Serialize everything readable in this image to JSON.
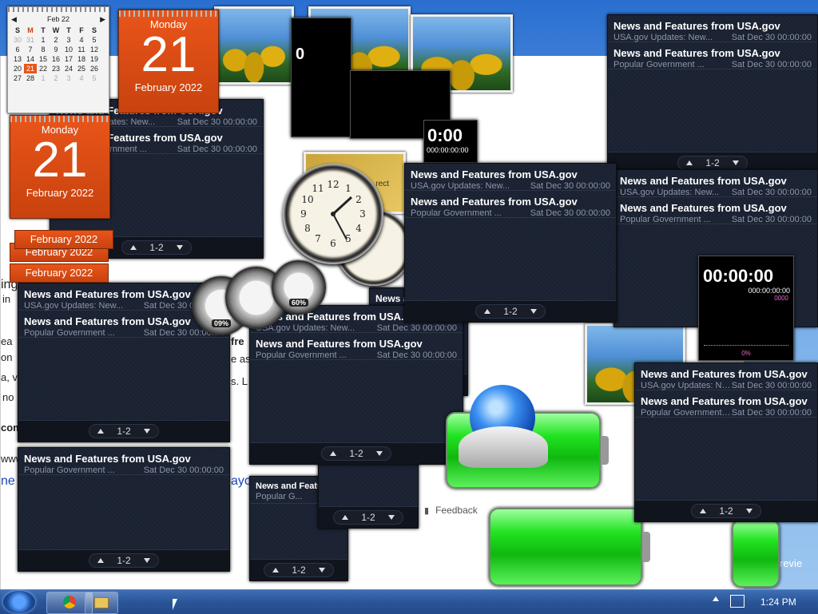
{
  "calendar_mini": {
    "month": "Feb 22",
    "weekdays": [
      "S",
      "M",
      "T",
      "W",
      "T",
      "F",
      "S"
    ],
    "rows": [
      [
        "30",
        "31",
        "1",
        "2",
        "3",
        "4",
        "5"
      ],
      [
        "6",
        "7",
        "8",
        "9",
        "10",
        "11",
        "12"
      ],
      [
        "13",
        "14",
        "15",
        "16",
        "17",
        "18",
        "19"
      ],
      [
        "20",
        "21",
        "22",
        "23",
        "24",
        "25",
        "26"
      ],
      [
        "27",
        "28",
        "1",
        "2",
        "3",
        "4",
        "5"
      ]
    ],
    "today": "21"
  },
  "calendar": {
    "weekday": "Monday",
    "day": "21",
    "month_year": "February 2022"
  },
  "feeds": [
    {
      "items": [
        {
          "title": "News and Features from USA.gov",
          "source": "USA.gov Updates: New...",
          "date": "Sat Dec 30 00:00:00"
        },
        {
          "title": "News and Features from USA.gov",
          "source": "Popular Government ...",
          "date": "Sat Dec 30 00:00:00"
        }
      ],
      "pager": "1-2"
    }
  ],
  "timer": {
    "main": "00:00:00",
    "sub": "000:00:00:00",
    "ms": "0000",
    "percent": "0%"
  },
  "meters": [
    {
      "label": "09%"
    },
    {
      "label": "60%"
    }
  ],
  "background": {
    "feedback": "Feedback",
    "fragments": [
      "ing",
      "in",
      "ea",
      "on",
      "a, v",
      "no",
      "com",
      "www",
      "ne",
      "fre",
      "e as",
      "s. L",
      "ayo",
      "revie",
      "rect"
    ]
  },
  "taskbar": {
    "time": "1:24 PM"
  }
}
